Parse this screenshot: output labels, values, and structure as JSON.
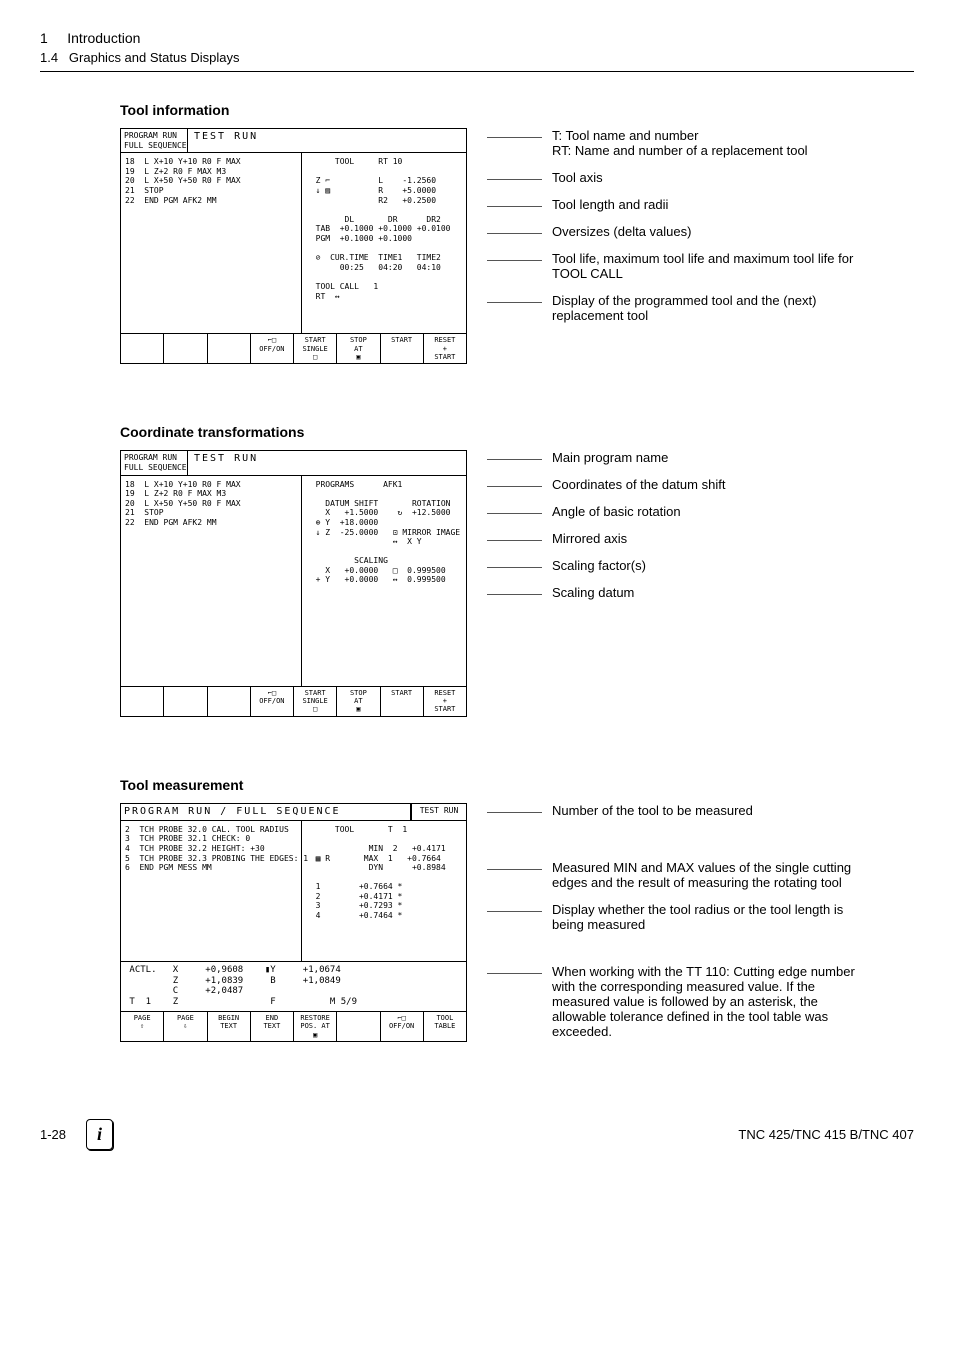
{
  "header": {
    "chapter_num": "1",
    "chapter_title": "Introduction",
    "section_num": "1.4",
    "section_title": "Graphics and Status Displays"
  },
  "sec1": {
    "title": "Tool information",
    "titlebar_left": "PROGRAM RUN\nFULL SEQUENCE",
    "titlebar_center": "TEST RUN",
    "prog": "18  L X+10 Y+10 R0 F MAX\n19  L Z+2 R0 F MAX M3\n20  L X+50 Y+50 R0 F MAX\n21  STOP\n22  END PGM AFK2 MM",
    "right": "      TOOL     RT 10\n\n  Z ⌐          L    -1.2560\n  ↓ ▨          R    +5.0000\n               R2   +0.2500\n\n        DL       DR      DR2\n  TAB  +0.1000 +0.1000 +0.0100\n  PGM  +0.1000 +0.1000\n\n  ⊘  CUR.TIME  TIME1   TIME2\n       00:25   04:20   04:10\n\n  TOOL CALL   1\n  RT  ↔",
    "softkeys": [
      "",
      "",
      "",
      "⌐□\nOFF/ON",
      "START\nSINGLE\n□",
      "STOP\nAT\n▣",
      "START",
      "RESET\n+\nSTART"
    ],
    "annotations": [
      "T: Tool name and number\nRT: Name and number of a replacement tool",
      "Tool axis",
      "Tool length and radii",
      "Oversizes (delta values)",
      "Tool life, maximum tool life and maximum tool life for TOOL CALL",
      "Display of the programmed tool and the (next) replacement tool"
    ]
  },
  "sec2": {
    "title": "Coordinate transformations",
    "titlebar_left": "PROGRAM RUN\nFULL SEQUENCE",
    "titlebar_center": "TEST RUN",
    "prog": "18  L X+10 Y+10 R0 F MAX\n19  L Z+2 R0 F MAX M3\n20  L X+50 Y+50 R0 F MAX\n21  STOP\n22  END PGM AFK2 MM",
    "right": "  PROGRAMS      AFK1\n\n    DATUM SHIFT       ROTATION\n    X   +1.5000    ↻  +12.5000\n  ⊕ Y  +18.0000\n  ↓ Z  -25.0000   ⊡ MIRROR IMAGE\n                  ↔  X Y\n\n          SCALING\n    X   +0.0000   □  0.999500\n  + Y   +0.0000   ↔  0.999500",
    "softkeys": [
      "",
      "",
      "",
      "⌐□\nOFF/ON",
      "START\nSINGLE\n□",
      "STOP\nAT\n▣",
      "START",
      "RESET\n+\nSTART"
    ],
    "annotations": [
      "Main program name",
      "Coordinates of the datum shift",
      "Angle of basic rotation",
      "Mirrored axis",
      "Scaling factor(s)",
      "Scaling datum"
    ]
  },
  "sec3": {
    "title": "Tool measurement",
    "titlebar_left": "PROGRAM RUN / FULL SEQUENCE",
    "titlebar_right": "TEST RUN",
    "prog": "2  TCH PROBE 32.0 CAL. TOOL RADIUS\n3  TCH PROBE 32.1 CHECK: 0\n4  TCH PROBE 32.2 HEIGHT: +30\n5  TCH PROBE 32.3 PROBING THE EDGES: 1\n6  END PGM MESS MM",
    "right": "      TOOL       T  1\n\n             MIN  2   +0.4171\n  ▦ R       MAX  1   +0.7664\n             DYN      +0.8984\n\n  1        +0.7664 *\n  2        +0.4171 *\n  3        +0.7293 *\n  4        +0.7464 *",
    "status": " ACTL.   X     +0,9608    ▮Y     +1,0674\n         Z     +1,0839     B     +1,0849\n         C     +2,0487\n T  1    Z                 F          M 5/9",
    "softkeys": [
      "PAGE\n⇧",
      "PAGE\n⇩",
      "BEGIN\nTEXT",
      "END\nTEXT",
      "RESTORE\nPOS. AT\n▣",
      "",
      "⌐□\nOFF/ON",
      "TOOL\nTABLE"
    ],
    "annotations": [
      "Number of the tool to be measured",
      "Measured MIN and MAX values of the single cutting edges and the result of measuring the rotating tool",
      "Display whether the tool radius or the tool length is being measured",
      "When working with the TT 110: Cutting edge number with the corresponding measured value. If the measured value is followed by an asterisk, the allowable tolerance defined in the tool table was exceeded."
    ]
  },
  "footer": {
    "page": "1-28",
    "model": "TNC 425/TNC 415 B/TNC 407"
  }
}
